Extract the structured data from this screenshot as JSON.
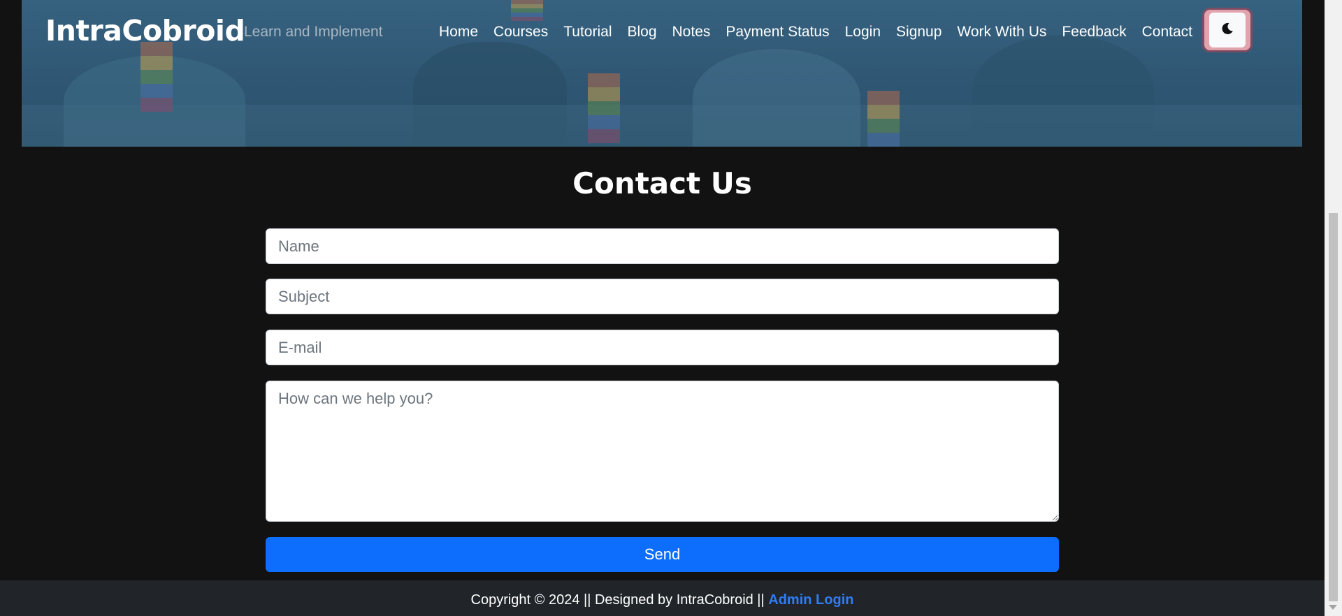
{
  "brand": {
    "name": "IntraCobroid",
    "tagline": "Learn and Implement"
  },
  "nav": {
    "items": [
      {
        "label": "Home"
      },
      {
        "label": "Courses"
      },
      {
        "label": "Tutorial"
      },
      {
        "label": "Blog"
      },
      {
        "label": "Notes"
      },
      {
        "label": "Payment Status"
      },
      {
        "label": "Login"
      },
      {
        "label": "Signup"
      },
      {
        "label": "Work With Us"
      },
      {
        "label": "Feedback"
      },
      {
        "label": "Contact"
      }
    ],
    "theme_toggle_icon": "moon-icon"
  },
  "contact": {
    "title": "Contact Us",
    "name_placeholder": "Name",
    "subject_placeholder": "Subject",
    "email_placeholder": "E-mail",
    "message_placeholder": "How can we help you?",
    "send_label": "Send"
  },
  "footer": {
    "text": "Copyright © 2024 || Designed by IntraCobroid || ",
    "admin_link": "Admin Login"
  },
  "colors": {
    "accent": "#0d6efd",
    "background": "#121212",
    "footer_bg": "#212529",
    "toggle_ring": "#dc3545"
  }
}
